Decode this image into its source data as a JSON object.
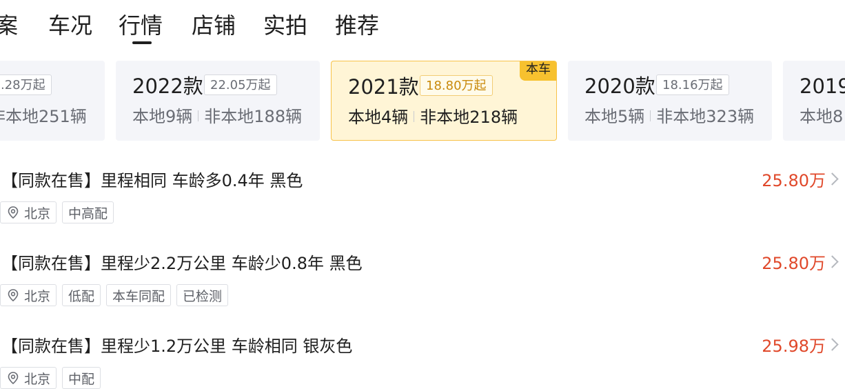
{
  "tabs": [
    {
      "label": "案"
    },
    {
      "label": "车况"
    },
    {
      "label": "行情",
      "active": true
    },
    {
      "label": "店铺"
    },
    {
      "label": "实拍"
    },
    {
      "label": "推荐"
    }
  ],
  "years": [
    {
      "year": "",
      "price": ".28万起",
      "local": "",
      "nonlocal": "非本地251辆"
    },
    {
      "year": "2022款",
      "price": "22.05万起",
      "local": "本地9辆",
      "nonlocal": "非本地188辆"
    },
    {
      "year": "2021款",
      "price": "18.80万起",
      "local": "本地4辆",
      "nonlocal": "非本地218辆",
      "selected": true,
      "badge": "本车"
    },
    {
      "year": "2020款",
      "price": "18.16万起",
      "local": "本地5辆",
      "nonlocal": "非本地323辆"
    },
    {
      "year": "2019",
      "price": "",
      "local": "本地8",
      "nonlocal": ""
    }
  ],
  "listings": [
    {
      "title": "【同款在售】里程相同 车龄多0.4年 黑色",
      "price": "25.80万",
      "city": "北京",
      "tags": [
        "中高配"
      ]
    },
    {
      "title": "【同款在售】里程少2.2万公里 车龄少0.8年 黑色",
      "price": "25.80万",
      "city": "北京",
      "tags": [
        "低配",
        "本车同配",
        "已检测"
      ]
    },
    {
      "title": "【同款在售】里程少1.2万公里 车龄相同 银灰色",
      "price": "25.98万",
      "city": "北京",
      "tags": [
        "中配"
      ]
    }
  ],
  "colors": {
    "accent_price": "#e0482a",
    "badge": "#f7c12f",
    "selected_card_bg": "#fff5d6"
  },
  "icons": {
    "location": "location-pin-icon",
    "chevron": "chevron-right-icon"
  }
}
